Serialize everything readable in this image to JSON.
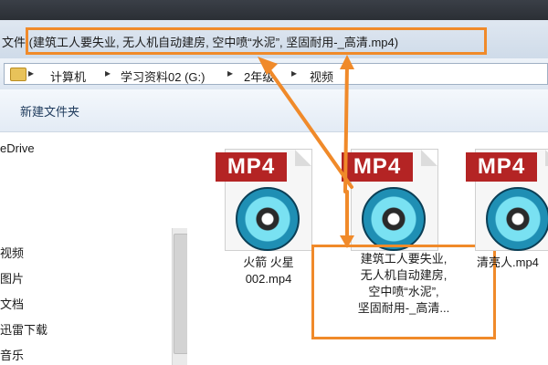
{
  "window": {
    "title": "文件 (建筑工人要失业, 无人机自动建房, 空中喷“水泥”, 坚固耐用-_高清.mp4)"
  },
  "address": {
    "crumbs": [
      "计算机",
      "学习资料02 (G:)",
      "2年级",
      "视频"
    ]
  },
  "toolbar": {
    "new_folder": "新建文件夹"
  },
  "sidebar": {
    "items": [
      "eDrive",
      "视频",
      "图片",
      "文档",
      "迅雷下载",
      "音乐"
    ]
  },
  "files": [
    {
      "badge": "MP4",
      "name_lines": [
        "火箭 火星",
        "002.mp4"
      ]
    },
    {
      "badge": "MP4",
      "name_lines": [
        "建筑工人要失业,",
        "无人机自动建房,",
        "空中喷“水泥”,",
        "坚固耐用-_高清..."
      ]
    },
    {
      "badge": "MP4",
      "name_lines": [
        "清亮人.mp4"
      ]
    }
  ],
  "colors": {
    "highlight": "#f08a2a",
    "badge": "#b42424"
  }
}
